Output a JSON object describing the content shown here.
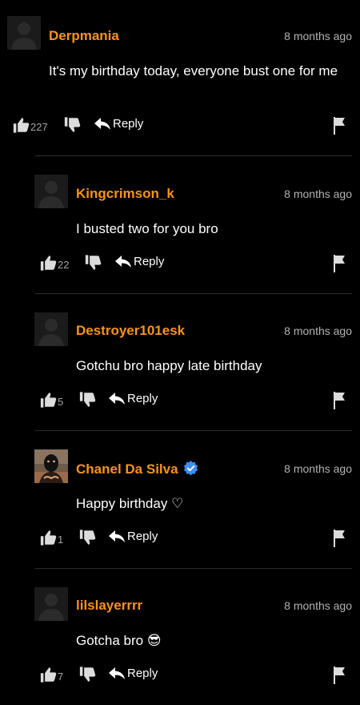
{
  "comments": [
    {
      "username": "Derpmania",
      "time": "8 months ago",
      "text": "It's my birthday today, everyone bust one for me",
      "likes": "227",
      "reply_label": "Reply",
      "verified": false,
      "avatar": "default-avatar"
    },
    {
      "username": "Kingcrimson_k",
      "time": "8 months ago",
      "text": "I busted two for you bro",
      "likes": "22",
      "reply_label": "Reply",
      "verified": false,
      "avatar": "default-avatar"
    },
    {
      "username": "Destroyer101esk",
      "time": "8 months ago",
      "text": "Gotchu bro happy late birthday",
      "likes": "5",
      "reply_label": "Reply",
      "verified": false,
      "avatar": "default-avatar"
    },
    {
      "username": "Chanel Da Silva",
      "time": "8 months ago",
      "text": "Happy birthday ♡",
      "likes": "1",
      "reply_label": "Reply",
      "verified": true,
      "avatar": "photo-avatar"
    },
    {
      "username": "lilslayerrrr",
      "time": "8 months ago",
      "text": "Gotcha bro 😎",
      "likes": "7",
      "reply_label": "Reply",
      "verified": false,
      "avatar": "default-avatar"
    }
  ],
  "colors": {
    "background": "#000000",
    "username": "#f7941d",
    "verified_badge": "#3d8ef0",
    "count": "#a5a5a5"
  }
}
